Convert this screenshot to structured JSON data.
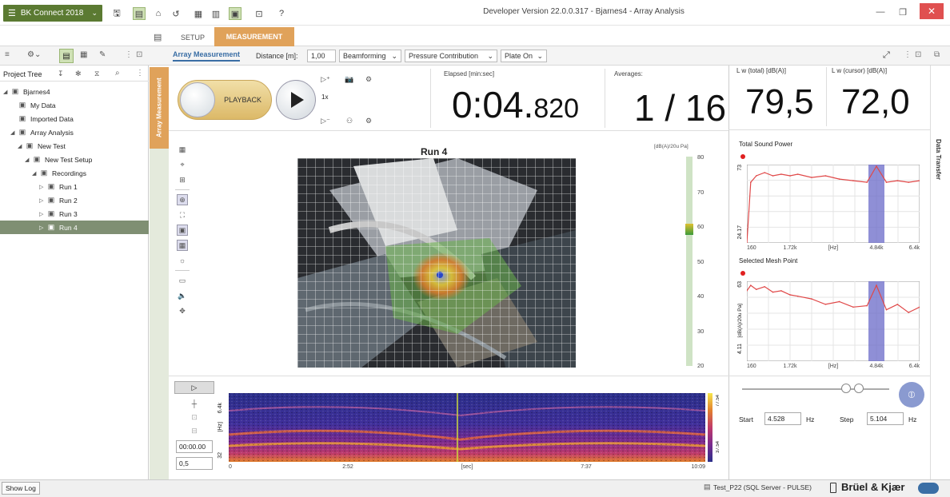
{
  "app": {
    "menu_label": "BK Connect 2018",
    "window_title": "Developer Version 22.0.0.317 - Bjarnes4 - Array Analysis",
    "help": "?"
  },
  "tabs": {
    "setup": "SETUP",
    "measurement": "MEASUREMENT"
  },
  "toolbar": {
    "array_measurement": "Array Measurement",
    "distance_label": "Distance [m]:",
    "distance_value": "1,00",
    "beamforming": "Beamforming",
    "pressure_contribution": "Pressure Contribution",
    "plate_on": "Plate On"
  },
  "tree": {
    "header": "Project Tree",
    "items": [
      {
        "label": "Bjarnes4",
        "indent": 0,
        "twisty": "◢"
      },
      {
        "label": "My Data",
        "indent": 1,
        "twisty": ""
      },
      {
        "label": "Imported Data",
        "indent": 1,
        "twisty": ""
      },
      {
        "label": "Array Analysis",
        "indent": 1,
        "twisty": "◢"
      },
      {
        "label": "New Test",
        "indent": 2,
        "twisty": "◢"
      },
      {
        "label": "New Test Setup",
        "indent": 3,
        "twisty": "◢"
      },
      {
        "label": "Recordings",
        "indent": 4,
        "twisty": "◢"
      },
      {
        "label": "Run 1",
        "indent": 5,
        "twisty": "▷"
      },
      {
        "label": "Run 2",
        "indent": 5,
        "twisty": "▷"
      },
      {
        "label": "Run 3",
        "indent": 5,
        "twisty": "▷"
      },
      {
        "label": "Run 4",
        "indent": 5,
        "twisty": "▷",
        "selected": true
      }
    ]
  },
  "side_tab": "Array Measurement",
  "controls": {
    "playback_label": "PLAYBACK",
    "speed": "1x",
    "elapsed_label": "Elapsed [min:sec]",
    "elapsed_main": "0:04.",
    "elapsed_frac": "820",
    "averages_label": "Averages:",
    "averages_value": "1 / 16"
  },
  "levels": {
    "lw_total_label": "L w (total) [dB(A)]",
    "lw_total_value": "79,5",
    "lw_cursor_label": "L w (cursor) [dB(A)]",
    "lw_cursor_value": "72,0"
  },
  "beamform_map": {
    "title": "Run 4",
    "scale_unit": "[dB(A)/20u Pa]",
    "scale_ticks": [
      "80",
      "70",
      "60",
      "50",
      "40",
      "30",
      "20"
    ]
  },
  "spectrogram": {
    "y_top": "6.4k",
    "y_unit": "[Hz]",
    "y_bottom": "32",
    "x_ticks": [
      "0",
      "2:52",
      "[sec]",
      "7:37",
      "10:09"
    ],
    "scale_top": "77.54",
    "scale_bottom": "37.54",
    "time_value": "00:00.00",
    "step_value": "0,5"
  },
  "chart_data": [
    {
      "type": "line",
      "title": "Total Sound Power",
      "ylabel": "",
      "y_tick_top": "73",
      "y_tick_bottom": "24.17",
      "x_ticks": [
        "160",
        "1.72k",
        "[Hz]",
        "4.84k",
        "6.4k"
      ],
      "highlight_band": "4.84k",
      "x": [
        160,
        300,
        500,
        800,
        1100,
        1400,
        1720,
        2000,
        2500,
        3000,
        3500,
        4000,
        4500,
        4840,
        5200,
        5600,
        6000,
        6400
      ],
      "values": [
        24.17,
        62,
        66,
        68,
        66,
        67,
        66,
        67,
        65,
        66,
        64,
        63,
        62,
        72,
        62,
        63,
        62,
        63
      ]
    },
    {
      "type": "line",
      "title": "Selected Mesh Point",
      "ylabel": "[dB(A)/20u Pa]",
      "y_tick_top": "63",
      "y_tick_bottom": "4.11",
      "x_ticks": [
        "160",
        "1.72k",
        "[Hz]",
        "4.84k",
        "6.4k"
      ],
      "highlight_band": "4.84k",
      "x": [
        160,
        300,
        500,
        800,
        1100,
        1400,
        1720,
        2000,
        2500,
        3000,
        3500,
        4000,
        4500,
        4840,
        5200,
        5600,
        6000,
        6400
      ],
      "values": [
        56,
        60,
        57,
        59,
        55,
        56,
        53,
        52,
        50,
        46,
        48,
        44,
        45,
        60,
        42,
        46,
        40,
        44
      ]
    }
  ],
  "freq_controls": {
    "start_label": "Start",
    "start_value": "4.528",
    "start_unit": "Hz",
    "step_label": "Step",
    "step_value": "5.104",
    "step_unit": "Hz"
  },
  "data_transfer": "Data Transfer",
  "status": {
    "show_log": "Show Log",
    "db_info": "Test_P22 (SQL Server - PULSE)",
    "brand": "Brüel & Kjær"
  }
}
